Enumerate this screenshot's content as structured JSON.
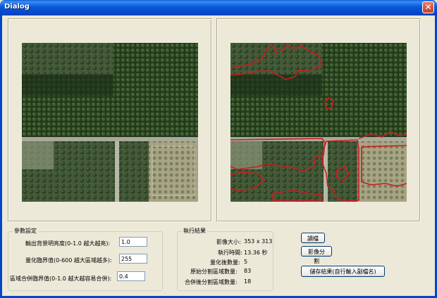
{
  "window": {
    "title": "Dialog",
    "close_glyph": "✕"
  },
  "params": {
    "title": "參數設定",
    "rows": [
      {
        "label": "輸出背景明亮度(0-1.0 越大越亮):",
        "value": "1.0"
      },
      {
        "label": "量化臨界值(0-600 越大區域越多):",
        "value": "255"
      },
      {
        "label": "區域合併臨界值(0-1.0 越大越容易合併):",
        "value": "0.4"
      }
    ]
  },
  "results": {
    "title": "執行結果",
    "rows": [
      {
        "label": "影像大小:",
        "value": "353 x 313"
      },
      {
        "label": "執行時間:",
        "value": "13.36 秒"
      },
      {
        "label": "量化後數量:",
        "value": "5"
      },
      {
        "label": "原始分割區域數量:",
        "value": "83"
      },
      {
        "label": "合併後分割區域數量:",
        "value": "18"
      }
    ]
  },
  "buttons": {
    "load": "讀檔",
    "segment": "影像分割",
    "save": "儲存結果(自行輸入副檔名)"
  },
  "colors": {
    "titlebar": "#0A5FD8",
    "dialog_bg": "#ECE9D8",
    "segment_outline": "#C81E1E"
  }
}
